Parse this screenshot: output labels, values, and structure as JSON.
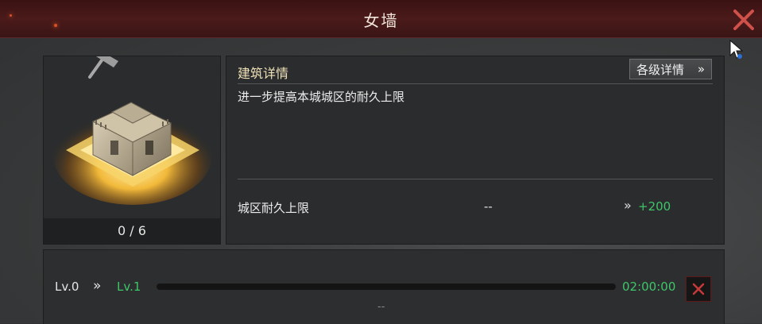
{
  "window": {
    "title": "女墙"
  },
  "icons": {
    "close": "close-x-icon",
    "hammer": "hammer-icon",
    "cursor": "mouse-cursor-icon"
  },
  "building": {
    "progress_text": "0 / 6"
  },
  "details": {
    "section_title": "建筑详情",
    "levels_button_label": "各级详情",
    "levels_button_arrow": "»",
    "description": "进一步提高本城城区的耐久上限",
    "stat": {
      "label": "城区耐久上限",
      "current": "--",
      "arrow": "»",
      "next": "+200"
    }
  },
  "upgrade": {
    "current_level": "Lv.0",
    "arrow": "»",
    "next_level": "Lv.1",
    "progress": 0,
    "time": "02:00:00",
    "footer_text": "--"
  },
  "colors": {
    "accent_green": "#3fc56a",
    "close_red": "#d0504a",
    "title_bar": "#4b1a1a"
  }
}
